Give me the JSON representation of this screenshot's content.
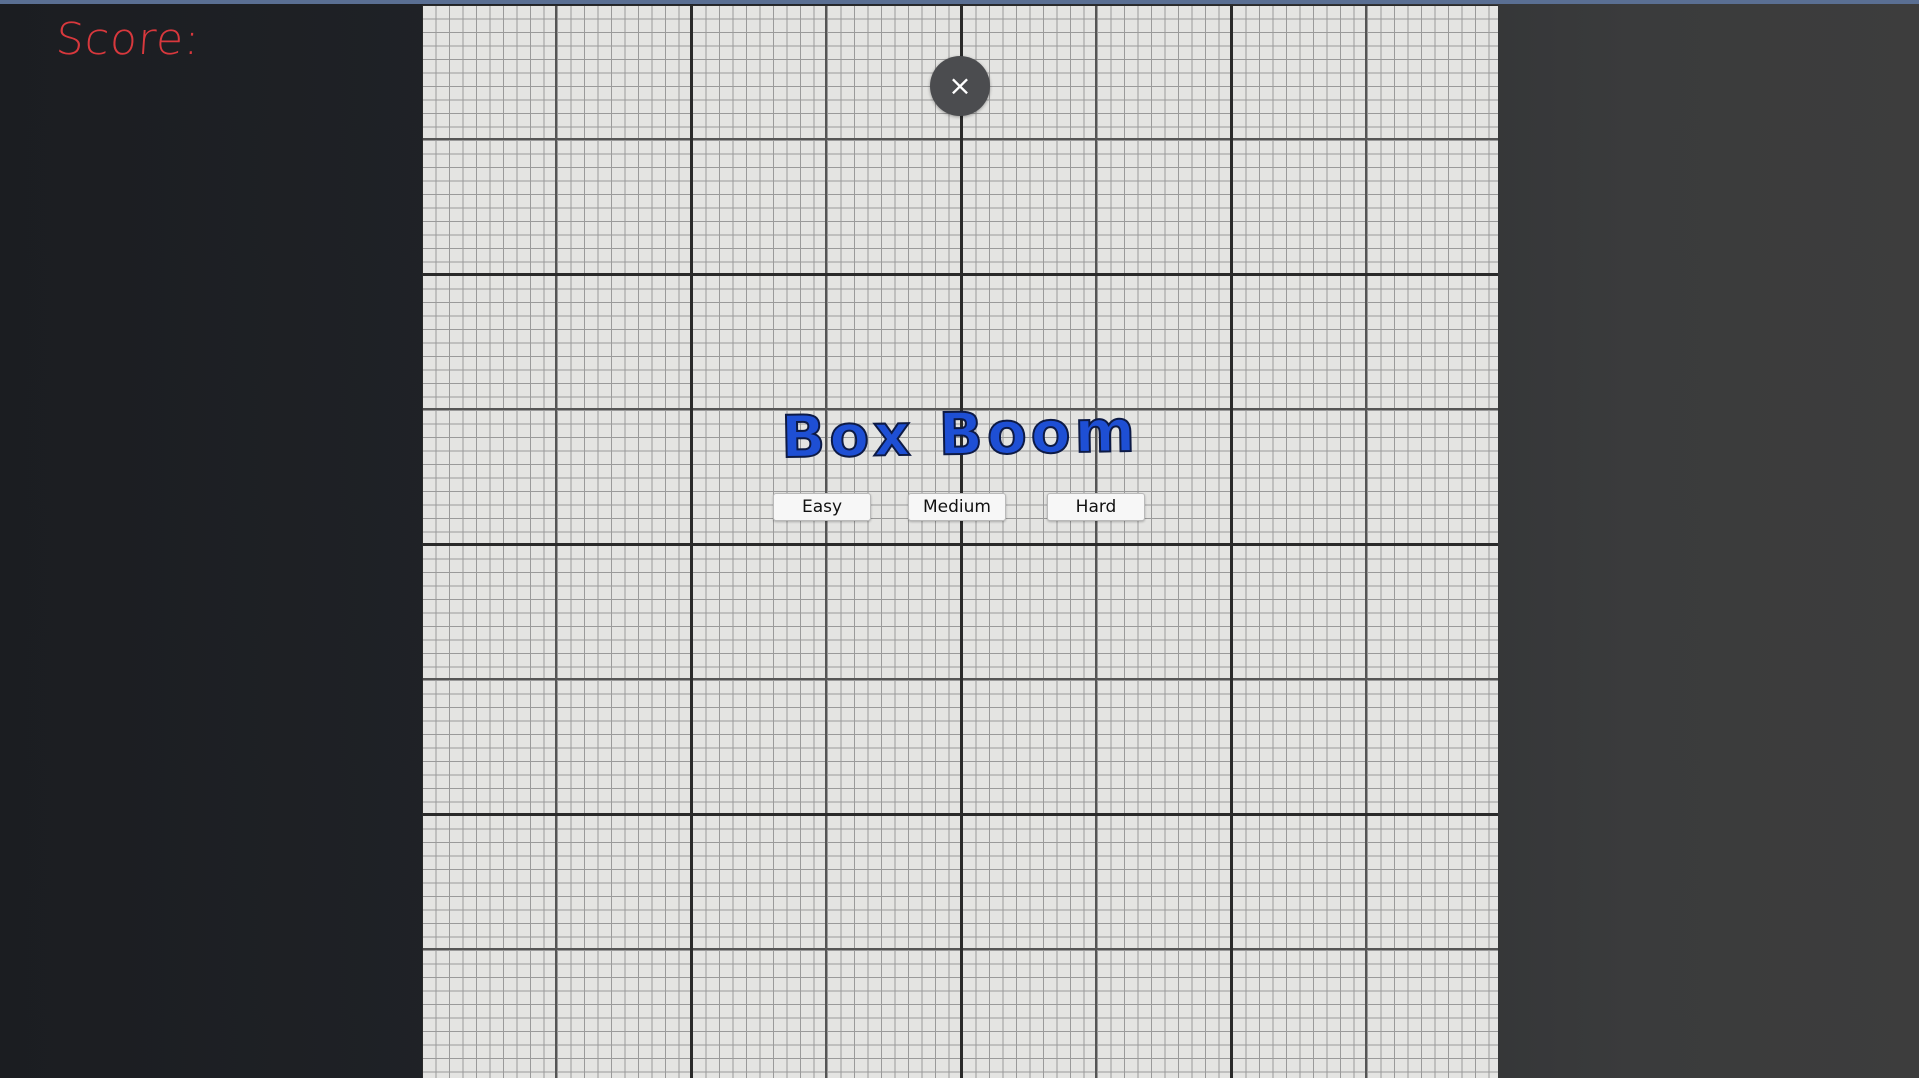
{
  "hud": {
    "score_label": "Score:"
  },
  "menu": {
    "close_glyph": "×",
    "title": "Box Boom",
    "difficulty_buttons": [
      {
        "label": "Easy"
      },
      {
        "label": "Medium"
      },
      {
        "label": "Hard"
      }
    ]
  },
  "colors": {
    "score_text": "#d8383d",
    "title_text": "#1e4fd4",
    "board_background": "#e4e4e2",
    "close_button_bg": "#4b4c4f"
  },
  "icons": {
    "close": "close-icon"
  }
}
